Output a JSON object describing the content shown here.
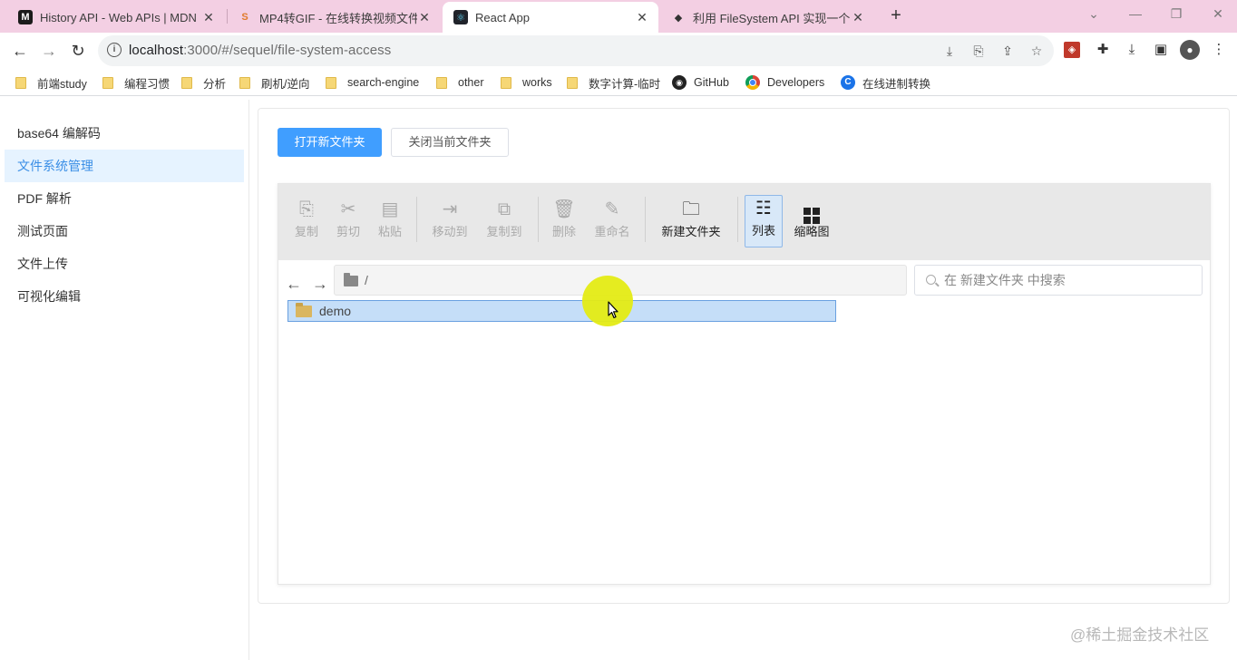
{
  "browser": {
    "tabs": [
      {
        "title": "History API - Web APIs | MDN",
        "favicon": "M",
        "active": false
      },
      {
        "title": "MP4转GIF - 在线转换视频文件",
        "favicon": "S",
        "active": false
      },
      {
        "title": "React App",
        "favicon": "⚛",
        "active": true
      },
      {
        "title": "利用 FileSystem API 实现一个 w",
        "favicon": "◆",
        "active": false
      }
    ],
    "url_host": "localhost",
    "url_path": ":3000/#/sequel/file-system-access",
    "bookmarks": [
      {
        "label": "前端study",
        "icon": "folder-icon"
      },
      {
        "label": "编程习惯",
        "icon": "folder-icon"
      },
      {
        "label": "分析",
        "icon": "folder-icon"
      },
      {
        "label": "刷机/逆向",
        "icon": "folder-icon"
      },
      {
        "label": "search-engine",
        "icon": "folder-icon"
      },
      {
        "label": "other",
        "icon": "folder-icon"
      },
      {
        "label": "works",
        "icon": "folder-icon"
      },
      {
        "label": "数字计算-临时",
        "icon": "folder-icon"
      },
      {
        "label": "GitHub",
        "icon": "github-icon"
      },
      {
        "label": "Developers",
        "icon": "chrome-icon"
      },
      {
        "label": "在线进制转换",
        "icon": "converter-icon"
      }
    ]
  },
  "sidebar": {
    "items": [
      {
        "label": "base64 编解码",
        "active": false
      },
      {
        "label": "文件系统管理",
        "active": true
      },
      {
        "label": "PDF 解析",
        "active": false
      },
      {
        "label": "测试页面",
        "active": false
      },
      {
        "label": "文件上传",
        "active": false
      },
      {
        "label": "可视化编辑",
        "active": false
      }
    ]
  },
  "main": {
    "open_button": "打开新文件夹",
    "close_button": "关闭当前文件夹"
  },
  "file_manager": {
    "toolbar": [
      {
        "label": "复制",
        "icon": "copy-icon",
        "enabled": false
      },
      {
        "label": "剪切",
        "icon": "cut-icon",
        "enabled": false
      },
      {
        "label": "粘贴",
        "icon": "paste-icon",
        "enabled": false
      },
      {
        "label": "移动到",
        "icon": "move-to-icon",
        "enabled": false
      },
      {
        "label": "复制到",
        "icon": "copy-to-icon",
        "enabled": false
      },
      {
        "label": "删除",
        "icon": "delete-icon",
        "enabled": false
      },
      {
        "label": "重命名",
        "icon": "rename-icon",
        "enabled": false
      },
      {
        "label": "新建文件夹",
        "icon": "new-folder-icon",
        "enabled": true
      },
      {
        "label": "列表",
        "icon": "list-view-icon",
        "enabled": true,
        "selected": true
      },
      {
        "label": "缩略图",
        "icon": "thumbnail-view-icon",
        "enabled": true
      }
    ],
    "path": "/",
    "search_placeholder": "在 新建文件夹 中搜索",
    "files": [
      {
        "name": "demo",
        "type": "folder",
        "selected": true
      }
    ]
  },
  "watermark": "@稀土掘金技术社区",
  "colors": {
    "tabstrip": "#f3cfe3",
    "primary": "#409eff",
    "sidebar_active_bg": "#e6f3ff",
    "sidebar_active_text": "#3a8ee6",
    "selection_bg": "#c5def8",
    "cursor_highlight": "#e4eb14"
  }
}
